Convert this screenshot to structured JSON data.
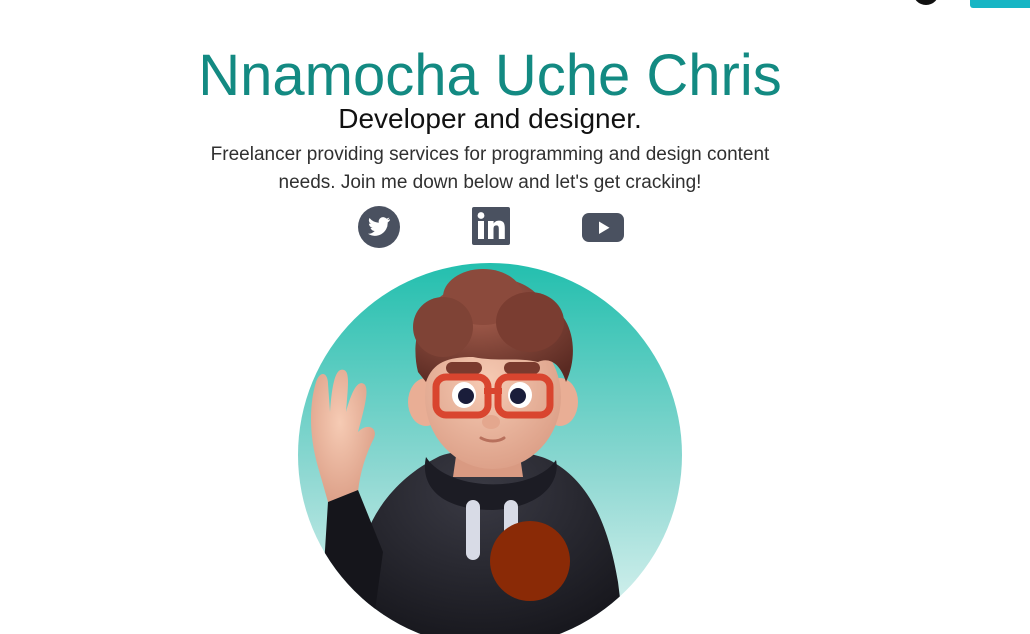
{
  "hero": {
    "name": "Nnamocha Uche Chris",
    "tagline": "Developer and designer.",
    "blurb": "Freelancer providing services for programming and design content needs. Join me down below and let's get cracking!"
  },
  "socials": [
    {
      "icon": "twitter-icon"
    },
    {
      "icon": "linkedin-icon"
    },
    {
      "icon": "youtube-icon"
    }
  ],
  "colors": {
    "name": "#138a82",
    "icon": "#4a5160",
    "accent_button": "#17b5c4",
    "avatar_gradient_top": "#23bfae",
    "avatar_gradient_bottom": "#e6f7f5",
    "cursor_circle": "#8a2a06"
  }
}
